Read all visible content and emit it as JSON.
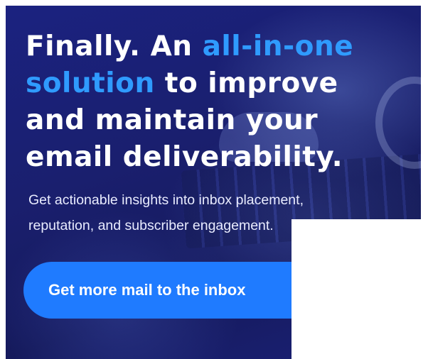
{
  "headline": {
    "line1_prefix": "Finally. An ",
    "line1_highlight": "all-in-one",
    "line2_highlight": "solution",
    "line2_suffix": " to improve",
    "line3": "and maintain your",
    "line4": "email deliverability."
  },
  "subtext": {
    "line1": "Get actionable insights into inbox placement,",
    "line2": "reputation, and subscriber engagement."
  },
  "cta": {
    "label": "Get more mail to the inbox"
  },
  "colors": {
    "background": "#1a1f6e",
    "highlight": "#2f9bff",
    "button": "#1f7bff",
    "text": "#ffffff"
  }
}
